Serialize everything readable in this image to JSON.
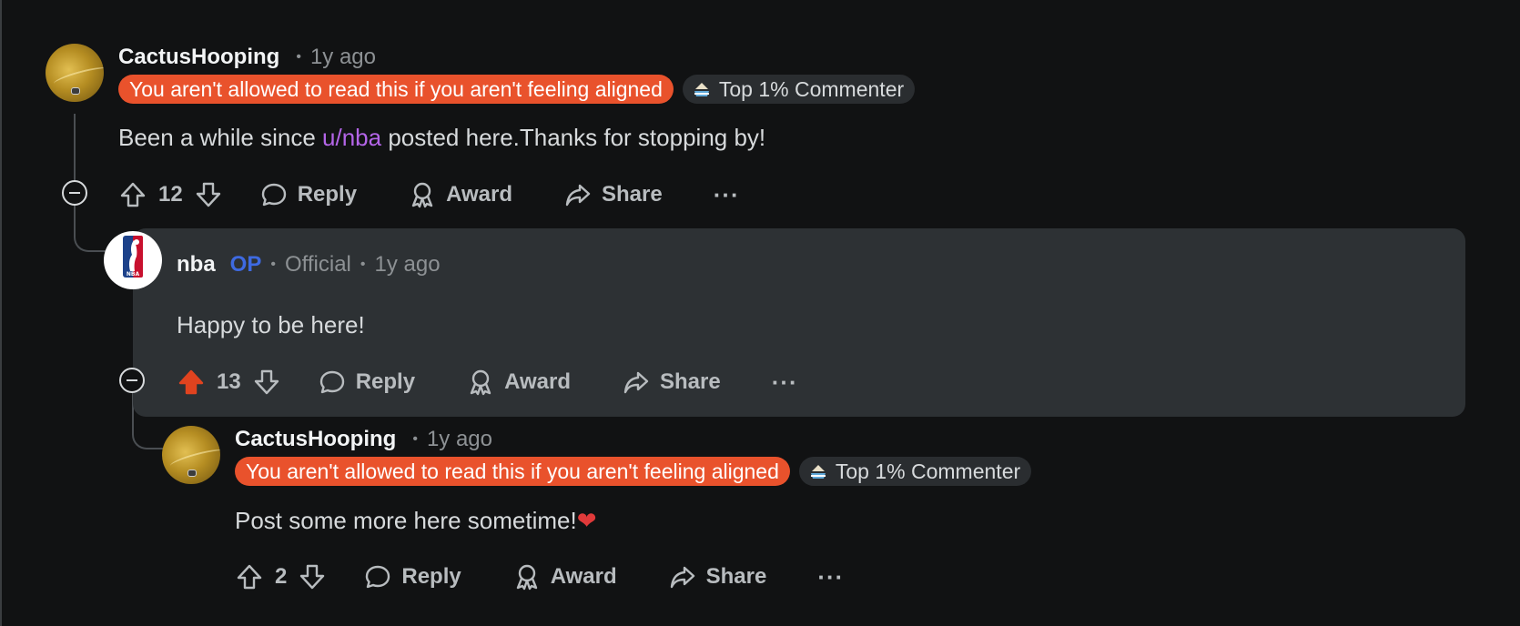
{
  "comment1": {
    "username": "CactusHooping",
    "time": "1y ago",
    "flair": "You aren't allowed to read this if you aren't feeling aligned",
    "badge": "Top 1% Commenter",
    "body_pre": "Been a while since ",
    "mention": "u/nba",
    "body_post": " posted here.Thanks for stopping by!",
    "votes": "12",
    "reply": "Reply",
    "award": "Award",
    "share": "Share",
    "more": "···"
  },
  "comment2": {
    "username": "nba",
    "op": "OP",
    "official": "Official",
    "time": "1y ago",
    "body": "Happy to be here!",
    "votes": "13",
    "reply": "Reply",
    "award": "Award",
    "share": "Share",
    "more": "···"
  },
  "comment3": {
    "username": "CactusHooping",
    "time": "1y ago",
    "flair": "You aren't allowed to read this if you aren't feeling aligned",
    "badge": "Top 1% Commenter",
    "body": "Post some more here sometime!",
    "heart": "❤",
    "votes": "2",
    "reply": "Reply",
    "award": "Award",
    "share": "Share",
    "more": "···"
  },
  "colors": {
    "background": "#111213",
    "flair_orange": "#e9522c",
    "mention": "#b465e8",
    "op_blue": "#3e6ae1",
    "upvoted": "#e0431f"
  },
  "icons": [
    "upvote-icon",
    "downvote-icon",
    "reply-bubble-icon",
    "award-icon",
    "share-icon",
    "collapse-icon",
    "badge-icon"
  ]
}
